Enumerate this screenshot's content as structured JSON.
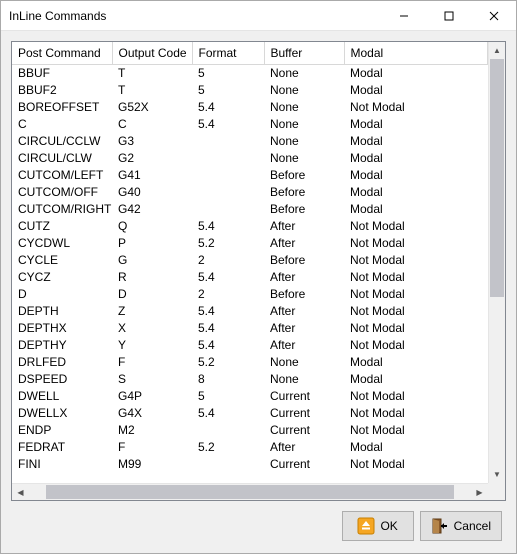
{
  "window": {
    "title": "InLine Commands"
  },
  "columns": [
    "Post Command",
    "Output Code",
    "Format",
    "Buffer",
    "Modal"
  ],
  "rows": [
    {
      "c0": "BBUF",
      "c1": "T",
      "c2": "5",
      "c3": "None",
      "c4": "Modal"
    },
    {
      "c0": "BBUF2",
      "c1": "T",
      "c2": "5",
      "c3": "None",
      "c4": "Modal"
    },
    {
      "c0": "BOREOFFSET",
      "c1": "G52X",
      "c2": "5.4",
      "c3": "None",
      "c4": "Not Modal"
    },
    {
      "c0": "C",
      "c1": "C",
      "c2": "5.4",
      "c3": "None",
      "c4": "Modal"
    },
    {
      "c0": "CIRCUL/CCLW",
      "c1": "G3",
      "c2": "",
      "c3": "None",
      "c4": "Modal"
    },
    {
      "c0": "CIRCUL/CLW",
      "c1": "G2",
      "c2": "",
      "c3": "None",
      "c4": "Modal"
    },
    {
      "c0": "CUTCOM/LEFT",
      "c1": "G41",
      "c2": "",
      "c3": "Before",
      "c4": "Modal"
    },
    {
      "c0": "CUTCOM/OFF",
      "c1": "G40",
      "c2": "",
      "c3": "Before",
      "c4": "Modal"
    },
    {
      "c0": "CUTCOM/RIGHT",
      "c1": "G42",
      "c2": "",
      "c3": "Before",
      "c4": "Modal"
    },
    {
      "c0": "CUTZ",
      "c1": "Q",
      "c2": "5.4",
      "c3": "After",
      "c4": "Not Modal"
    },
    {
      "c0": "CYCDWL",
      "c1": "P",
      "c2": "5.2",
      "c3": "After",
      "c4": "Not Modal"
    },
    {
      "c0": "CYCLE",
      "c1": "G",
      "c2": "2",
      "c3": "Before",
      "c4": "Not Modal"
    },
    {
      "c0": "CYCZ",
      "c1": "R",
      "c2": "5.4",
      "c3": "After",
      "c4": "Not Modal"
    },
    {
      "c0": "D",
      "c1": "D",
      "c2": "2",
      "c3": "Before",
      "c4": "Not Modal"
    },
    {
      "c0": "DEPTH",
      "c1": "Z",
      "c2": "5.4",
      "c3": "After",
      "c4": "Not Modal"
    },
    {
      "c0": "DEPTHX",
      "c1": "X",
      "c2": "5.4",
      "c3": "After",
      "c4": "Not Modal"
    },
    {
      "c0": "DEPTHY",
      "c1": "Y",
      "c2": "5.4",
      "c3": "After",
      "c4": "Not Modal"
    },
    {
      "c0": "DRLFED",
      "c1": "F",
      "c2": "5.2",
      "c3": "None",
      "c4": "Modal"
    },
    {
      "c0": "DSPEED",
      "c1": "S",
      "c2": "8",
      "c3": "None",
      "c4": "Modal"
    },
    {
      "c0": "DWELL",
      "c1": "G4P",
      "c2": "5",
      "c3": "Current",
      "c4": "Not Modal"
    },
    {
      "c0": "DWELLX",
      "c1": "G4X",
      "c2": "5.4",
      "c3": "Current",
      "c4": "Not Modal"
    },
    {
      "c0": "ENDP",
      "c1": "M2",
      "c2": "",
      "c3": "Current",
      "c4": "Not Modal"
    },
    {
      "c0": "FEDRAT",
      "c1": "F",
      "c2": "5.2",
      "c3": "After",
      "c4": "Modal"
    },
    {
      "c0": "FINI",
      "c1": "M99",
      "c2": "",
      "c3": "Current",
      "c4": "Not Modal"
    }
  ],
  "buttons": {
    "ok": "OK",
    "cancel": "Cancel"
  }
}
